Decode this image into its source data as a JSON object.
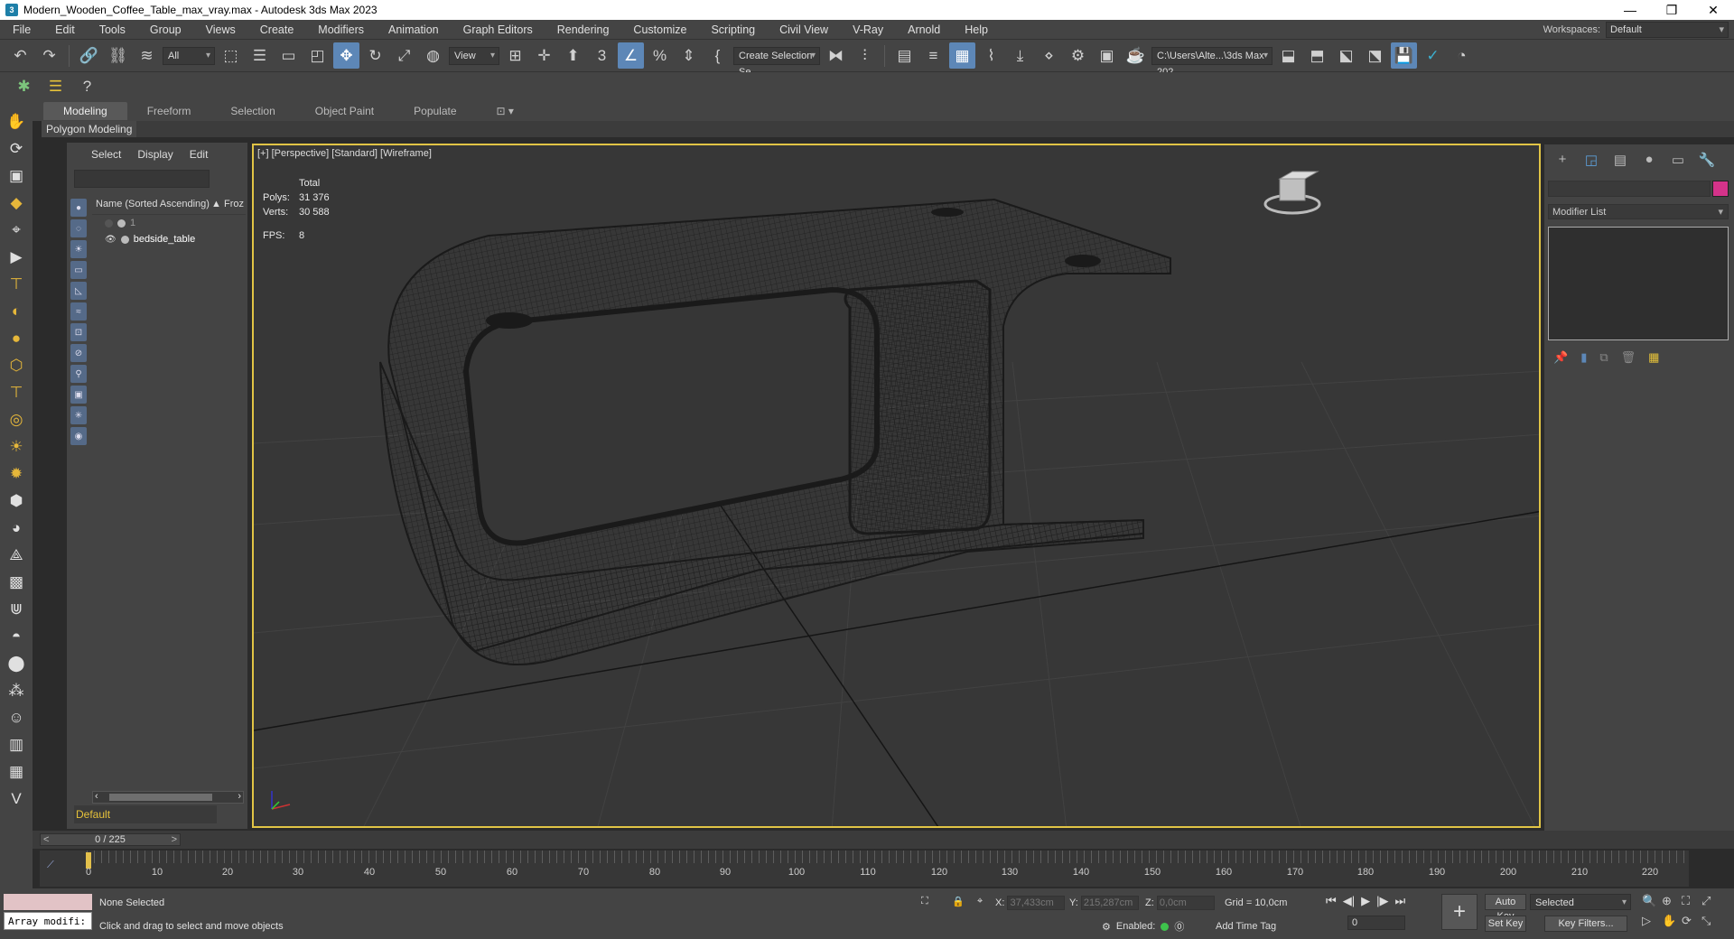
{
  "window": {
    "title": "Modern_Wooden_Coffee_Table_max_vray.max - Autodesk 3ds Max 2023",
    "icon": "3ds-max-icon",
    "controls": [
      "—",
      "❐",
      "✕"
    ]
  },
  "menu": [
    "File",
    "Edit",
    "Tools",
    "Group",
    "Views",
    "Create",
    "Modifiers",
    "Animation",
    "Graph Editors",
    "Rendering",
    "Customize",
    "Scripting",
    "Civil View",
    "V-Ray",
    "Arnold",
    "Help"
  ],
  "workspaces": {
    "label": "Workspaces:",
    "value": "Default"
  },
  "toolbar": {
    "selection_filter": "All",
    "ref_coord": "View",
    "named_selection": "Create Selection Se",
    "project_path": "C:\\Users\\Alte...\\3ds Max 202"
  },
  "ribbon": {
    "tabs": [
      "Modeling",
      "Freeform",
      "Selection",
      "Object Paint",
      "Populate"
    ],
    "active_tab": "Modeling",
    "sub_label": "Polygon Modeling"
  },
  "scene_explorer": {
    "tabs": [
      "Select",
      "Display",
      "Edit"
    ],
    "column_name": "Name (Sorted Ascending)",
    "column_frozen": "▲ Froz",
    "rows": [
      {
        "label": "1",
        "selected": false
      },
      {
        "label": "bedside_table",
        "selected": true
      }
    ],
    "layer": "Default"
  },
  "viewport": {
    "label": "[+] [Perspective] [Standard] [Wireframe]",
    "stats": {
      "header": "Total",
      "polys_label": "Polys:",
      "polys": "31 376",
      "verts_label": "Verts:",
      "verts": "30 588",
      "fps_label": "FPS:",
      "fps": "8"
    }
  },
  "command_panel": {
    "modifier_list": "Modifier List",
    "object_color": "#d4338a"
  },
  "timeline": {
    "slider_text": "0 / 225",
    "ticks": [
      "0",
      "10",
      "20",
      "30",
      "40",
      "50",
      "60",
      "70",
      "80",
      "90",
      "100",
      "110",
      "120",
      "130",
      "140",
      "150",
      "160",
      "170",
      "180",
      "190",
      "200",
      "210",
      "220"
    ]
  },
  "status": {
    "maxscript_text": "Array modifi:",
    "selection_text": "None Selected",
    "prompt_text": "Click and drag to select and move objects",
    "x_label": "X:",
    "x_value": "37,433cm",
    "y_label": "Y:",
    "y_value": "215,287cm",
    "z_label": "Z:",
    "z_value": "0,0cm",
    "grid": "Grid = 10,0cm",
    "enabled_label": "Enabled:",
    "add_time_tag": "Add Time Tag",
    "frame": "0",
    "auto_key": "Auto Key",
    "set_key": "Set Key",
    "key_mode": "Selected",
    "key_filters": "Key Filters..."
  },
  "colors": {
    "viewport_border": "#e1c445",
    "ui_bg": "#444444",
    "active_blue": "#5d87b7"
  }
}
